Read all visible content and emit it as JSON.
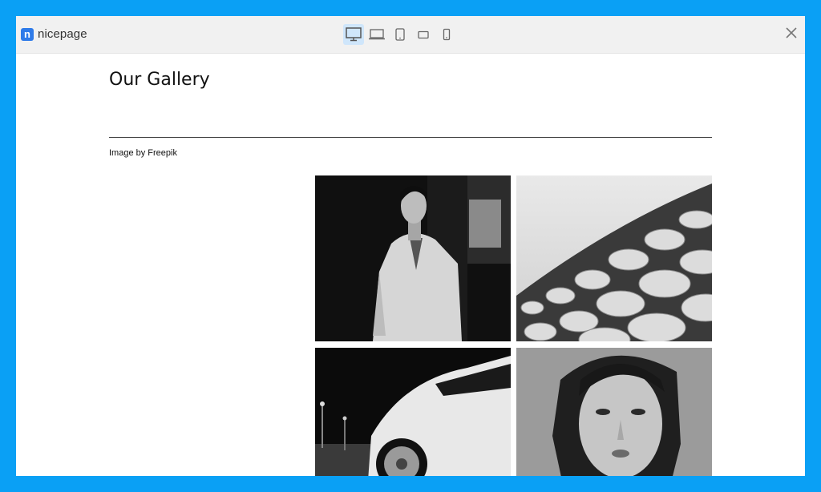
{
  "app": {
    "brand_mark": "n",
    "brand_name": "nicepage"
  },
  "toolbar": {
    "devices": [
      {
        "name": "desktop",
        "icon": "desktop-icon",
        "active": true
      },
      {
        "name": "laptop",
        "icon": "laptop-icon",
        "active": false
      },
      {
        "name": "tablet",
        "icon": "tablet-icon",
        "active": false
      },
      {
        "name": "phone-landscape",
        "icon": "phone-landscape-icon",
        "active": false
      },
      {
        "name": "phone",
        "icon": "phone-icon",
        "active": false
      }
    ],
    "close_icon": "close-icon"
  },
  "page": {
    "title": "Our Gallery",
    "credit": "Image by Freepik"
  },
  "gallery": {
    "images": [
      {
        "subject": "fashion-portrait-woman-white-blazer"
      },
      {
        "subject": "abstract-architecture-discs"
      },
      {
        "subject": "white-sports-car-night"
      },
      {
        "subject": "portrait-young-woman-closeup"
      }
    ]
  },
  "colors": {
    "frame": "#0aa0f5",
    "brand": "#2f7be9",
    "active_device": "#cfe6fb"
  }
}
